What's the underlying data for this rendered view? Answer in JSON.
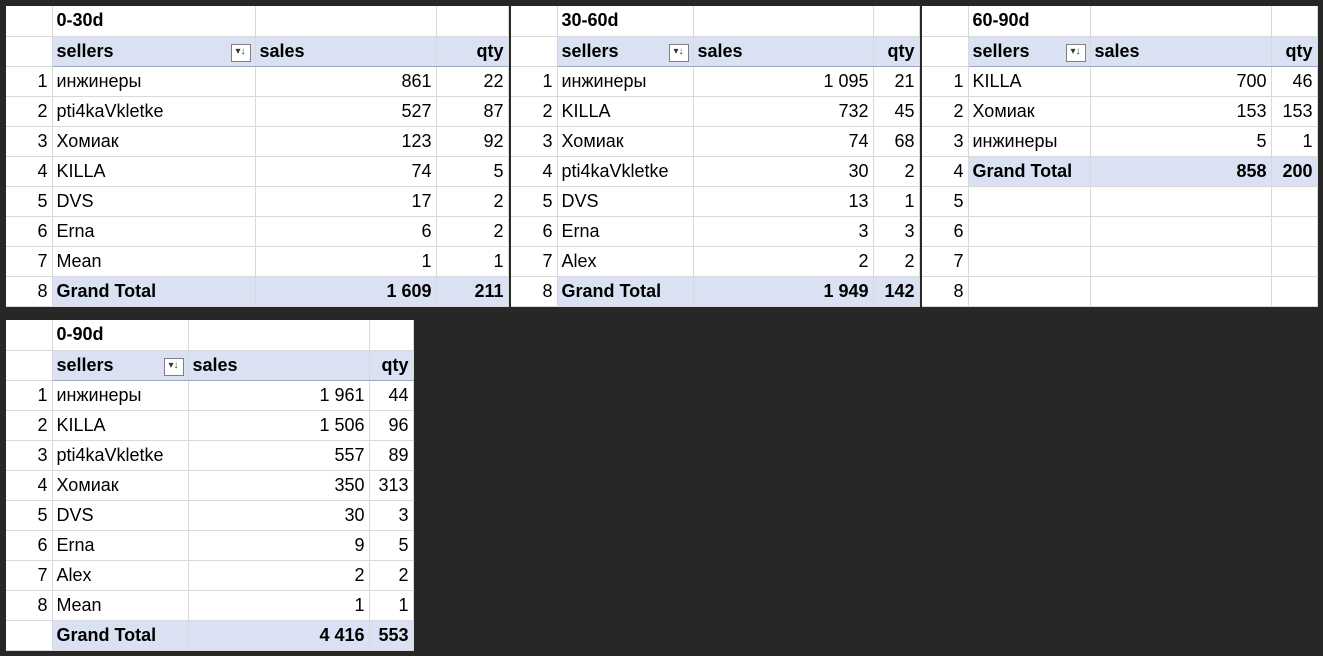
{
  "pivots": [
    {
      "title": "0-30d",
      "headers": {
        "sellers": "sellers",
        "sales": "sales",
        "qty": "qty"
      },
      "rows": [
        {
          "index": "1",
          "seller": "инжинеры",
          "sales": "861",
          "qty": "22"
        },
        {
          "index": "2",
          "seller": "pti4kaVkletke",
          "sales": "527",
          "qty": "87"
        },
        {
          "index": "3",
          "seller": "Хомиак",
          "sales": "123",
          "qty": "92"
        },
        {
          "index": "4",
          "seller": "KILLA",
          "sales": "74",
          "qty": "5"
        },
        {
          "index": "5",
          "seller": "DVS",
          "sales": "17",
          "qty": "2"
        },
        {
          "index": "6",
          "seller": "Erna",
          "sales": "6",
          "qty": "2"
        },
        {
          "index": "7",
          "seller": "Mean",
          "sales": "1",
          "qty": "1"
        }
      ],
      "total": {
        "index": "8",
        "label": "Grand Total",
        "sales": "1 609",
        "qty": "211"
      },
      "empty_rows": []
    },
    {
      "title": "30-60d",
      "headers": {
        "sellers": "sellers",
        "sales": "sales",
        "qty": "qty"
      },
      "rows": [
        {
          "index": "1",
          "seller": "инжинеры",
          "sales": "1 095",
          "qty": "21"
        },
        {
          "index": "2",
          "seller": "KILLA",
          "sales": "732",
          "qty": "45"
        },
        {
          "index": "3",
          "seller": "Хомиак",
          "sales": "74",
          "qty": "68"
        },
        {
          "index": "4",
          "seller": "pti4kaVkletke",
          "sales": "30",
          "qty": "2"
        },
        {
          "index": "5",
          "seller": "DVS",
          "sales": "13",
          "qty": "1"
        },
        {
          "index": "6",
          "seller": "Erna",
          "sales": "3",
          "qty": "3"
        },
        {
          "index": "7",
          "seller": "Alex",
          "sales": "2",
          "qty": "2"
        }
      ],
      "total": {
        "index": "8",
        "label": "Grand Total",
        "sales": "1 949",
        "qty": "142"
      },
      "empty_rows": []
    },
    {
      "title": "60-90d",
      "headers": {
        "sellers": "sellers",
        "sales": "sales",
        "qty": "qty"
      },
      "rows": [
        {
          "index": "1",
          "seller": "KILLA",
          "sales": "700",
          "qty": "46"
        },
        {
          "index": "2",
          "seller": "Хомиак",
          "sales": "153",
          "qty": "153"
        },
        {
          "index": "3",
          "seller": "инжинеры",
          "sales": "5",
          "qty": "1"
        }
      ],
      "total": {
        "index": "4",
        "label": "Grand Total",
        "sales": "858",
        "qty": "200"
      },
      "empty_rows": [
        "5",
        "6",
        "7",
        "8"
      ]
    },
    {
      "title": "0-90d",
      "headers": {
        "sellers": "sellers",
        "sales": "sales",
        "qty": "qty"
      },
      "rows": [
        {
          "index": "1",
          "seller": "инжинеры",
          "sales": "1 961",
          "qty": "44"
        },
        {
          "index": "2",
          "seller": "KILLA",
          "sales": "1 506",
          "qty": "96"
        },
        {
          "index": "3",
          "seller": "pti4kaVkletke",
          "sales": "557",
          "qty": "89"
        },
        {
          "index": "4",
          "seller": "Хомиак",
          "sales": "350",
          "qty": "313"
        },
        {
          "index": "5",
          "seller": "DVS",
          "sales": "30",
          "qty": "3"
        },
        {
          "index": "6",
          "seller": "Erna",
          "sales": "9",
          "qty": "5"
        },
        {
          "index": "7",
          "seller": "Alex",
          "sales": "2",
          "qty": "2"
        },
        {
          "index": "8",
          "seller": "Mean",
          "sales": "1",
          "qty": "1"
        }
      ],
      "total": {
        "index": "",
        "label": "Grand Total",
        "sales": "4 416",
        "qty": "553"
      },
      "empty_rows": []
    }
  ],
  "icons": {
    "filter": "filter-sort-icon"
  }
}
